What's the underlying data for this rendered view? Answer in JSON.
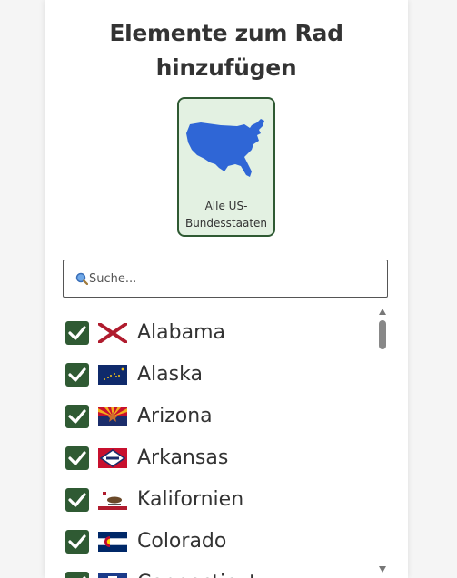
{
  "header": {
    "title_line1": "Elemente zum Rad",
    "title_line2": "hinzufügen"
  },
  "preset": {
    "label_line1": "Alle US-",
    "label_line2": "Bundesstaaten",
    "icon": "usa-map-icon",
    "color": "#2f66d6"
  },
  "search": {
    "placeholder": "Suche...",
    "value": "",
    "icon": "search-icon"
  },
  "items": [
    {
      "label": "Alabama",
      "checked": true,
      "flag": "alabama-flag-icon"
    },
    {
      "label": "Alaska",
      "checked": true,
      "flag": "alaska-flag-icon"
    },
    {
      "label": "Arizona",
      "checked": true,
      "flag": "arizona-flag-icon"
    },
    {
      "label": "Arkansas",
      "checked": true,
      "flag": "arkansas-flag-icon"
    },
    {
      "label": "Kalifornien",
      "checked": true,
      "flag": "california-flag-icon"
    },
    {
      "label": "Colorado",
      "checked": true,
      "flag": "colorado-flag-icon"
    },
    {
      "label": "Connecticut",
      "checked": true,
      "flag": "connecticut-flag-icon"
    }
  ],
  "colors": {
    "accent": "#2f5a33",
    "preset_bg": "#e3f1e2",
    "text": "#333333"
  }
}
